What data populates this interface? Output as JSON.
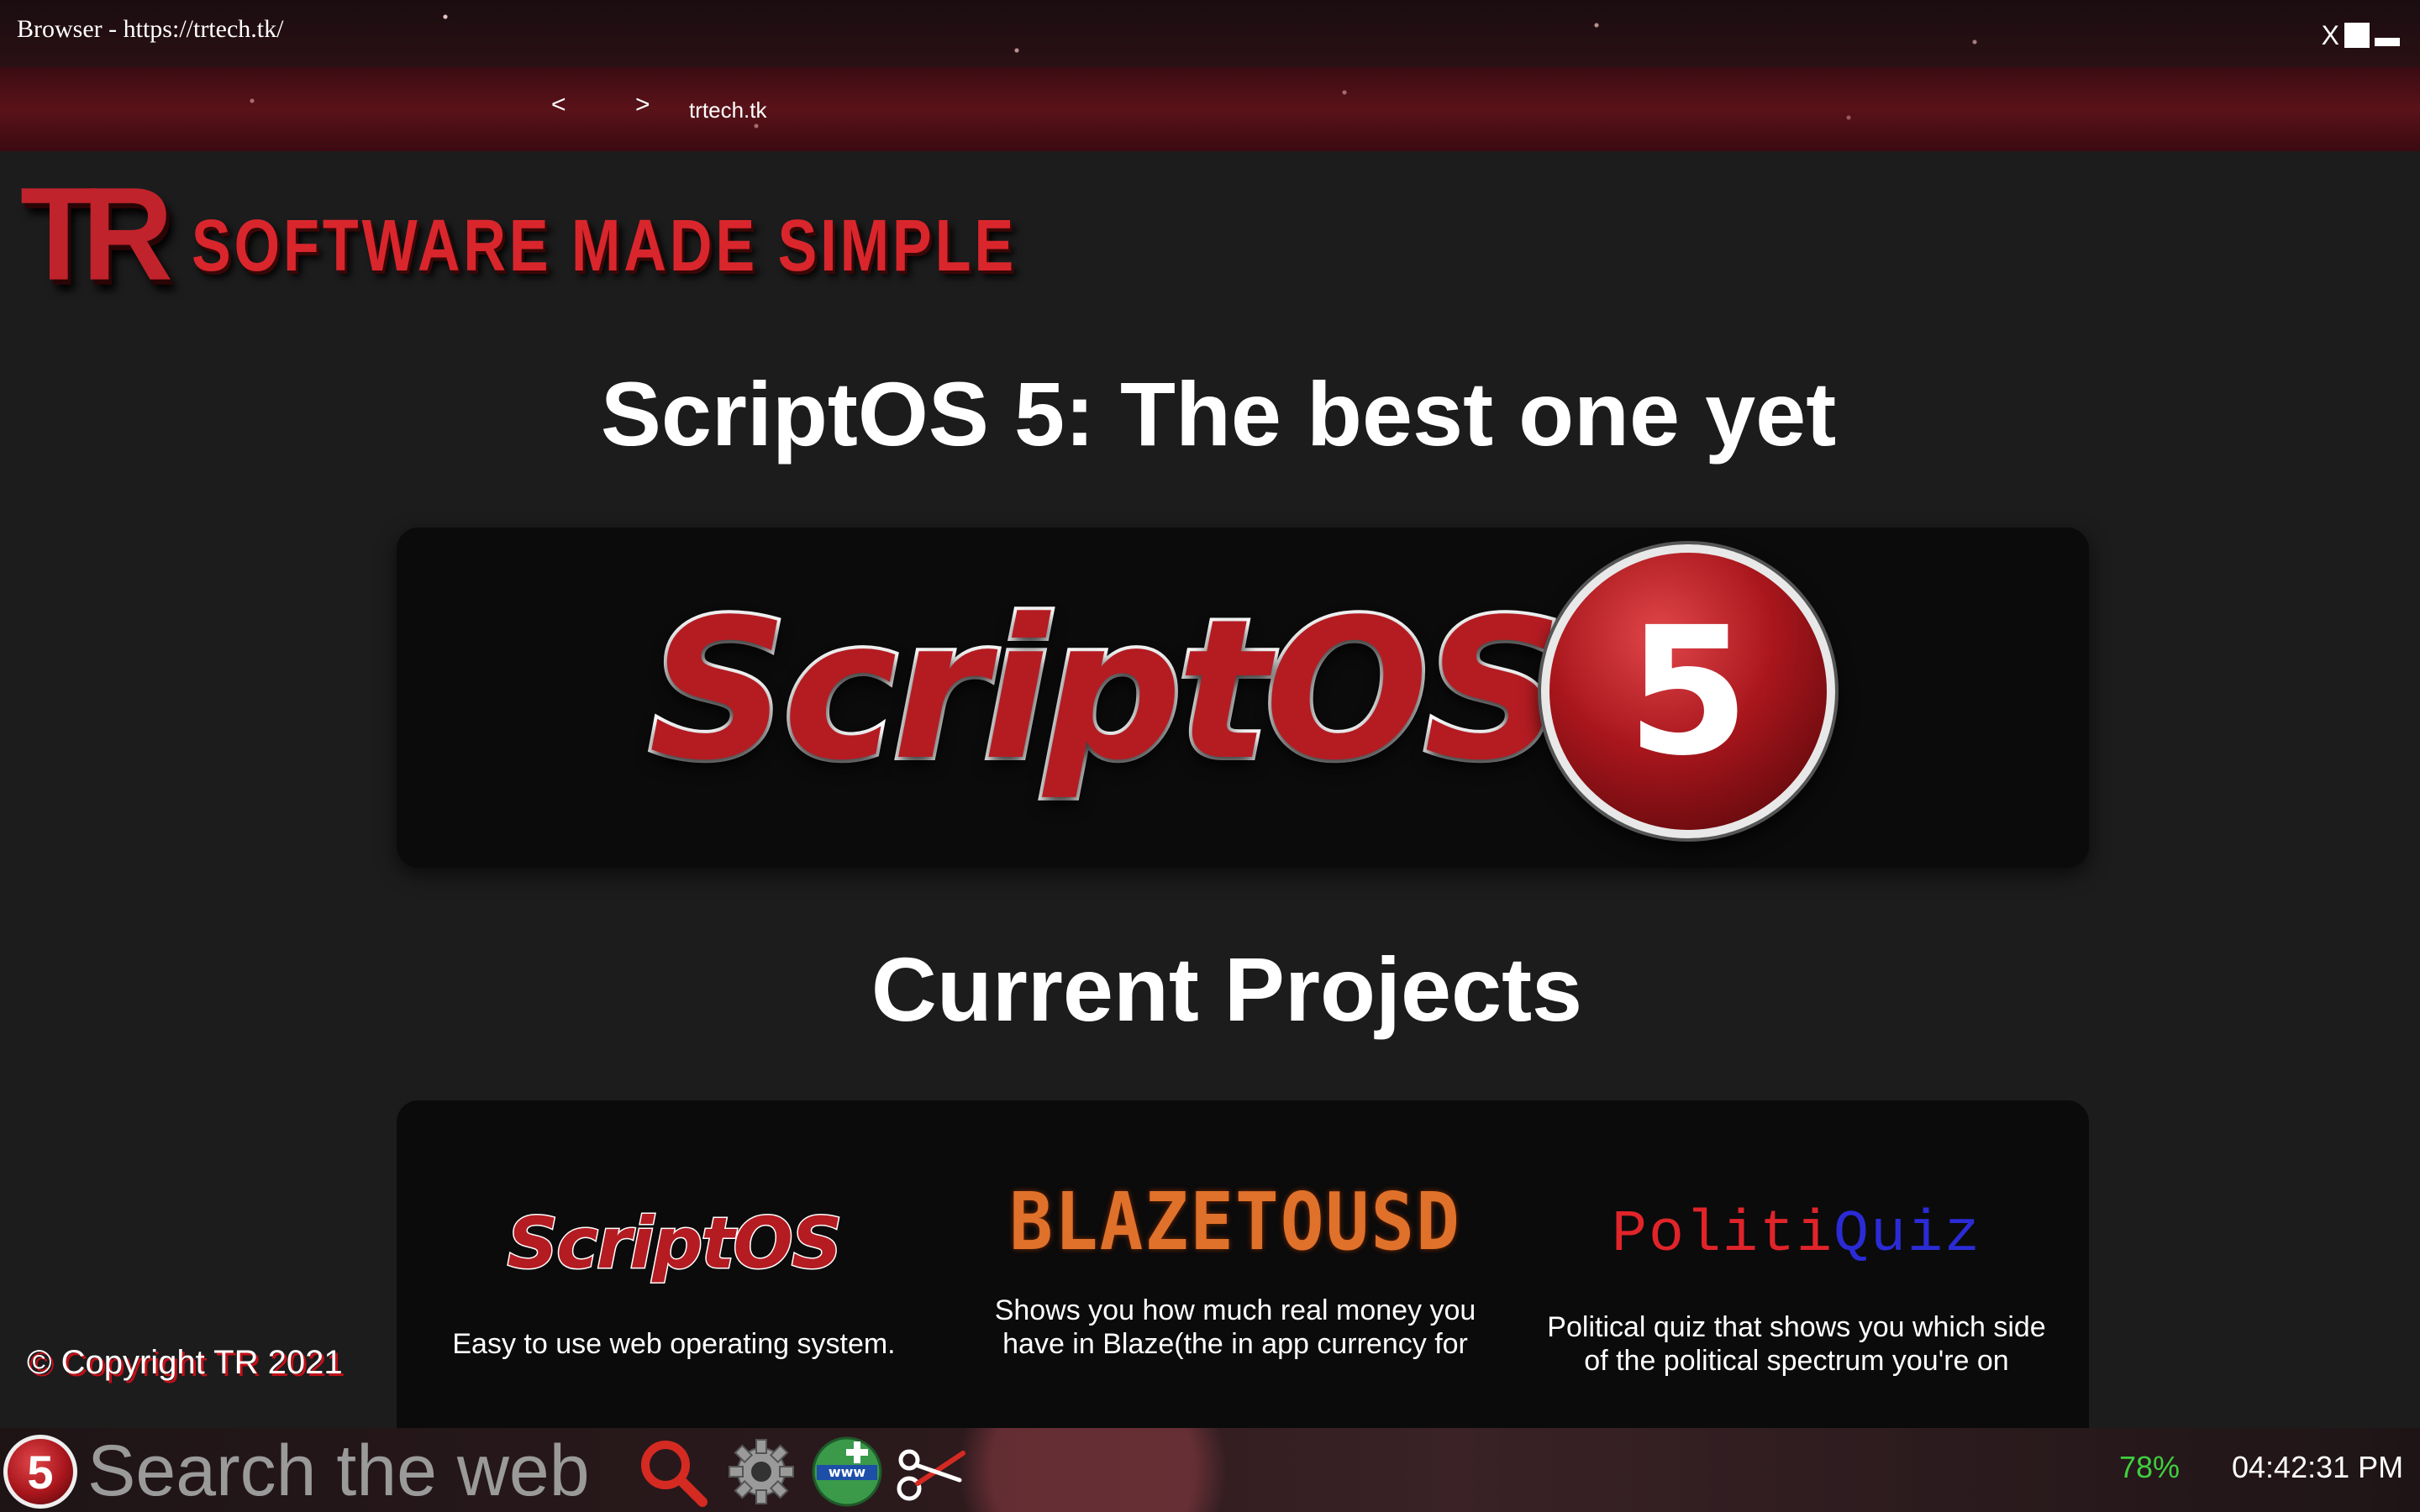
{
  "window": {
    "title": "Browser - https://trtech.tk/",
    "close_label": "X"
  },
  "nav": {
    "back_label": "<",
    "forward_label": ">",
    "url": "trtech.tk"
  },
  "site": {
    "logo_letters": "TR",
    "tagline": "SOFTWARE MADE SIMPLE",
    "hero_title": "ScriptOS 5: The best one yet",
    "hero_logo_word": "ScriptOS",
    "hero_logo_number": "5",
    "projects_title": "Current Projects",
    "projects": [
      {
        "name": "ScriptOS",
        "description": "Easy to use web operating system."
      },
      {
        "name": "BLAZETOUSD",
        "description": "Shows you how much real money you have in Blaze(the in app currency for"
      },
      {
        "name_part1": "Politi",
        "name_part2": "Quiz",
        "description": "Political quiz that shows you which side of the political spectrum you're on"
      }
    ],
    "copyright": "© Copyright TR 2021"
  },
  "taskbar": {
    "start_label": "5",
    "search_placeholder": "Search the web",
    "battery": "78%",
    "clock": "04:42:31 PM",
    "icons": [
      "search-icon",
      "settings-gear-icon",
      "browser-www-icon",
      "scissors-icon"
    ]
  },
  "colors": {
    "accent_red": "#c0232b",
    "battery_green": "#3fcf3f",
    "page_bg": "#1c1c1d"
  }
}
